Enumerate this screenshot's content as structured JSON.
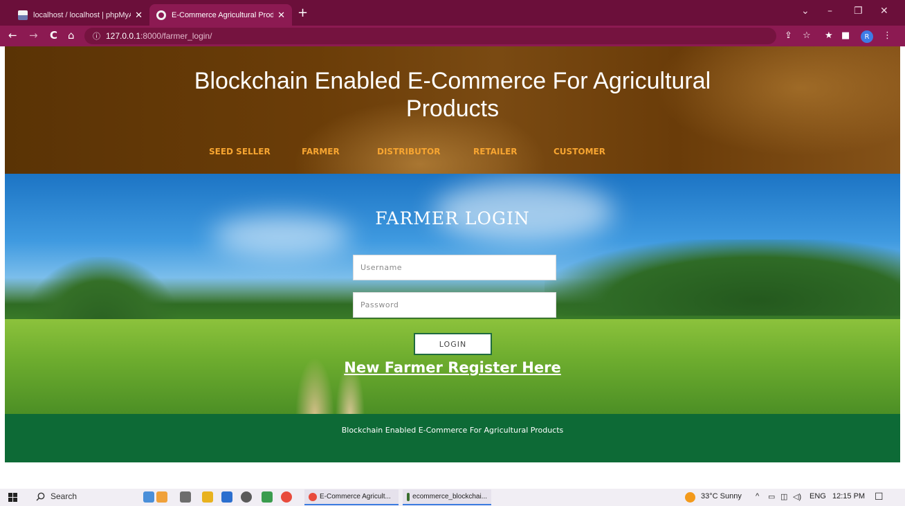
{
  "browser": {
    "tabs": [
      {
        "title": "localhost / localhost | phpMyAdm",
        "active": false
      },
      {
        "title": "E-Commerce Agricultural Produc",
        "active": true
      }
    ],
    "new_tab_symbol": "+",
    "window_controls": {
      "dropdown": "⌄",
      "minimize": "–",
      "maximize": "❐",
      "close": "✕"
    },
    "nav": {
      "back": "←",
      "forward": "→",
      "reload": "C",
      "home": "⌂"
    },
    "address": {
      "info_icon": "ⓘ",
      "host": "127.0.0.1",
      "path": ":8000/farmer_login/"
    },
    "toolbar_icons": {
      "share": "⇪",
      "star": "☆",
      "extensions": "★",
      "sidepanel": "■",
      "menu": "⋮"
    },
    "profile_initial": "R"
  },
  "site": {
    "title": "Blockchain Enabled E-Commerce For Agricultural Products",
    "nav": [
      "SEED SELLER",
      "FARMER",
      "DISTRIBUTOR",
      "RETAILER",
      "CUSTOMER"
    ],
    "accent_color": "#f7a531"
  },
  "login": {
    "heading": "FARMER LOGIN",
    "username_placeholder": "Username",
    "password_placeholder": "Password",
    "button_label": "LOGIN",
    "register_link": "New Farmer Register Here"
  },
  "footer": {
    "text": "Blockchain Enabled E-Commerce For Agricultural Products",
    "color": "#0d6a36"
  },
  "taskbar": {
    "search_label": "Search",
    "apps": [
      {
        "label": "E-Commerce Agricult..."
      },
      {
        "label": "ecommerce_blockchai..."
      }
    ],
    "weather": "33°C Sunny",
    "tray_chevron": "^",
    "language": "ENG",
    "time": "12:15 PM"
  }
}
